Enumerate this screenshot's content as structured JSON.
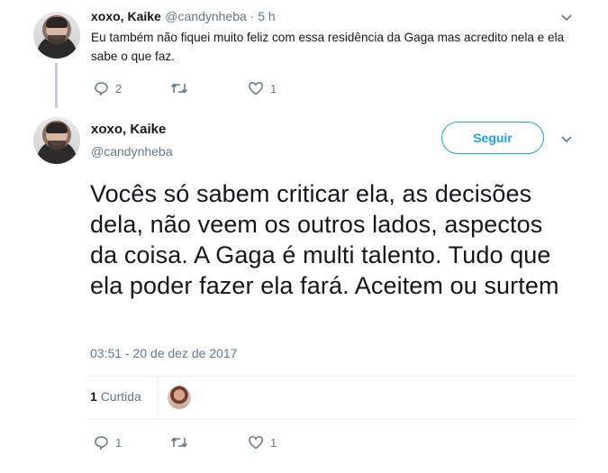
{
  "reply_tweet": {
    "display_name": "xoxo, Kaike",
    "handle_time": "@candynheba · 5 h",
    "text": "Eu também não fiquei muito feliz com essa residência da Gaga mas acredito nela e ela sabe o que faz.",
    "reply_count": "2",
    "like_count": "1"
  },
  "main_tweet": {
    "display_name": "xoxo, Kaike",
    "handle": "@candynheba",
    "follow_label": "Seguir",
    "text": "Vocês só sabem criticar ela, as decisões dela, não veem os outros lados, aspectos da coisa. A Gaga é multi talento. Tudo que ela poder fazer ela fará. Aceitem ou surtem",
    "timestamp": "03:51 - 20 de dez de 2017",
    "likes_number": "1",
    "likes_word": "Curtida",
    "reply_count": "1",
    "like_count": "1"
  },
  "icons": [
    "reply-icon",
    "retweet-icon",
    "heart-icon",
    "chevron-down-icon"
  ],
  "colors": {
    "accent": "#1da1f2",
    "muted": "#657786",
    "text": "#14171a",
    "divider": "#e6ecf0"
  }
}
